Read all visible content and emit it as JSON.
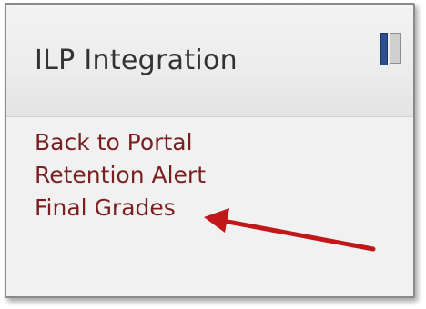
{
  "block": {
    "title": "ILP Integration",
    "dock_icon": "dock-block-icon"
  },
  "links": [
    {
      "label": "Back to Portal"
    },
    {
      "label": "Retention Alert"
    },
    {
      "label": "Final Grades"
    }
  ],
  "annotation": {
    "icon": "red-arrow-icon",
    "color": "#c01818"
  },
  "colors": {
    "link": "#7a1f1f",
    "title": "#333333",
    "dock_blue": "#2e4f8f"
  }
}
